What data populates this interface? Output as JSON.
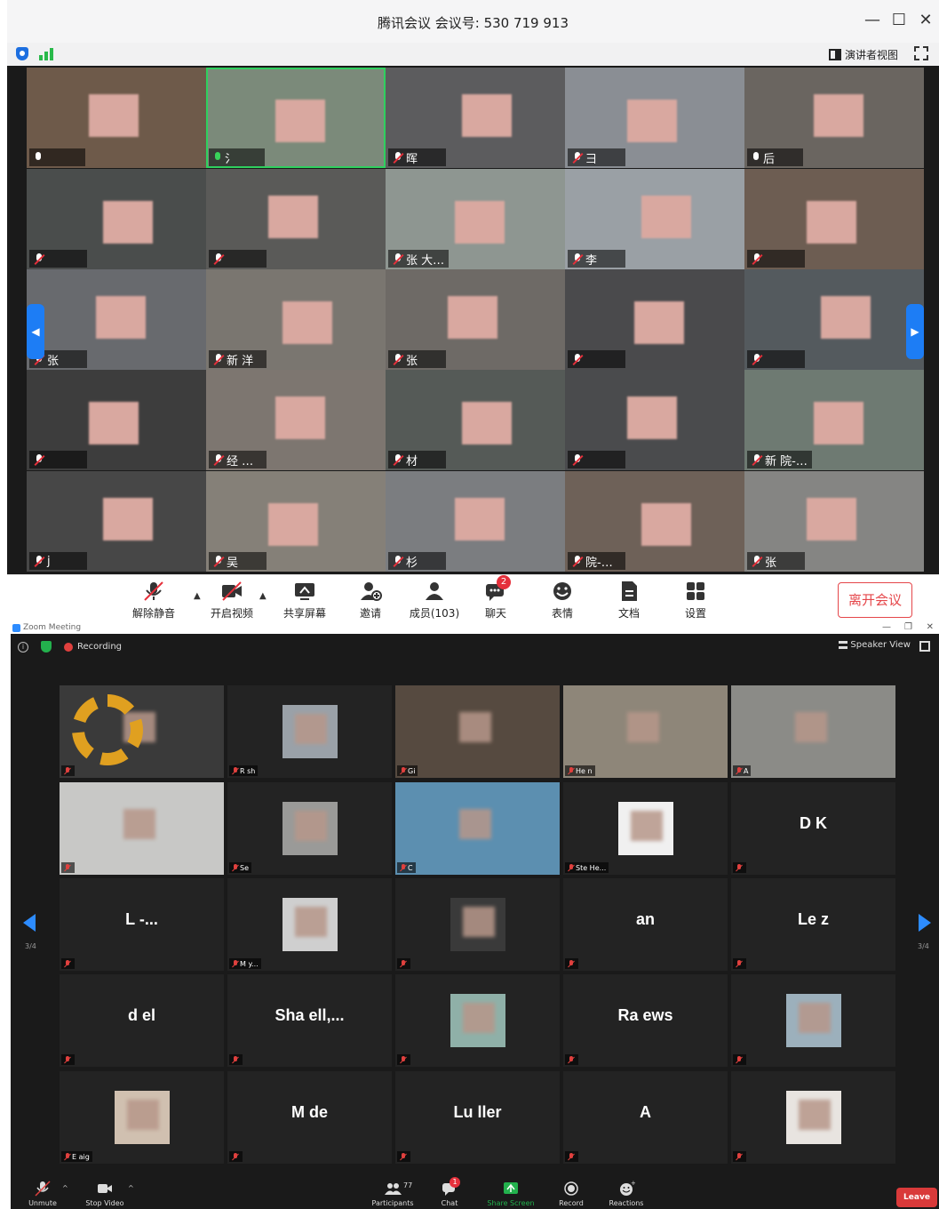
{
  "tencent": {
    "title": "腾讯会议 会议号: 530 719 913",
    "window_controls": [
      "—",
      "☐",
      "✕"
    ],
    "speaker_view_label": "演讲者视图",
    "tile_names": [
      "",
      "氵",
      "晖",
      "彐",
      "后",
      "",
      "",
      "张 大…",
      "李",
      "",
      "张",
      "新 洋",
      "张",
      "",
      "",
      "",
      "经 …",
      "材",
      "",
      "新 院-…",
      "j",
      "吴",
      "杉",
      "院-…",
      "张"
    ],
    "toolbar": {
      "unmute": "解除静音",
      "start_video": "开启视频",
      "share_screen": "共享屏幕",
      "invite": "邀请",
      "members": "成员(103)",
      "chat": "聊天",
      "chat_badge": "2",
      "reactions": "表情",
      "docs": "文档",
      "settings": "设置",
      "leave": "离开会议"
    }
  },
  "zoom": {
    "window_title": "Zoom Meeting",
    "recording_label": "Recording",
    "speaker_view_label": "Speaker View",
    "page_indicator": "3/4",
    "tiles": [
      {
        "name": "",
        "label": ""
      },
      {
        "name": "",
        "label": "R sh"
      },
      {
        "name": "",
        "label": "Gi"
      },
      {
        "name": "",
        "label": "He n"
      },
      {
        "name": "",
        "label": "A"
      },
      {
        "name": "",
        "label": ""
      },
      {
        "name": "",
        "label": "Se"
      },
      {
        "name": "",
        "label": "C"
      },
      {
        "name": "",
        "label": "Ste He..."
      },
      {
        "name": "D      K",
        "label": ""
      },
      {
        "name": "L              -...",
        "label": ""
      },
      {
        "name": "",
        "label": "M y..."
      },
      {
        "name": "",
        "label": ""
      },
      {
        "name": "      an",
        "label": ""
      },
      {
        "name": "Le        z",
        "label": ""
      },
      {
        "name": "d      el",
        "label": ""
      },
      {
        "name": "Sha        ell,...",
        "label": ""
      },
      {
        "name": "",
        "label": ""
      },
      {
        "name": "Ra          ews",
        "label": ""
      },
      {
        "name": "",
        "label": ""
      },
      {
        "name": "",
        "label": "E aig"
      },
      {
        "name": "M        de",
        "label": ""
      },
      {
        "name": "Lu      ller",
        "label": ""
      },
      {
        "name": "A",
        "label": ""
      },
      {
        "name": "",
        "label": ""
      }
    ],
    "toolbar": {
      "unmute": "Unmute",
      "stop_video": "Stop Video",
      "participants": "Participants",
      "participants_count": "77",
      "chat": "Chat",
      "chat_badge": "1",
      "share_screen": "Share Screen",
      "record": "Record",
      "reactions": "Reactions",
      "leave": "Leave"
    }
  },
  "colors": {
    "tencent_accent": "#1d7df5",
    "zoom_green": "#23b14d",
    "leave_red": "#d93a3a",
    "muted_red": "#e0403e"
  }
}
